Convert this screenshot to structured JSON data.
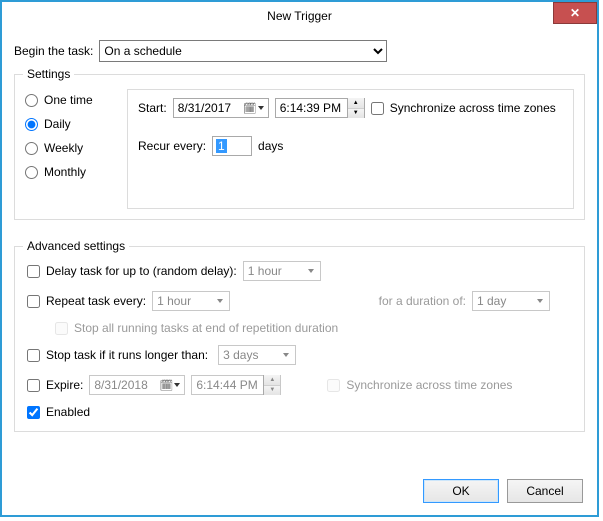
{
  "window": {
    "title": "New Trigger"
  },
  "begin": {
    "label": "Begin the task:",
    "selected": "On a schedule"
  },
  "settings": {
    "group_label": "Settings",
    "options": {
      "one_time": "One time",
      "daily": "Daily",
      "weekly": "Weekly",
      "monthly": "Monthly"
    },
    "selected": "daily",
    "start_label": "Start:",
    "start_date": "8/31/2017",
    "start_time": "6:14:39 PM",
    "sync_tz_label": "Synchronize across time zones",
    "recur_label": "Recur every:",
    "recur_value": "1",
    "recur_unit": "days"
  },
  "advanced": {
    "group_label": "Advanced settings",
    "delay_label": "Delay task for up to (random delay):",
    "delay_value": "1 hour",
    "repeat_label": "Repeat task every:",
    "repeat_value": "1 hour",
    "duration_label": "for a duration of:",
    "duration_value": "1 day",
    "stop_repeat_label": "Stop all running tasks at end of repetition duration",
    "stop_long_label": "Stop task if it runs longer than:",
    "stop_long_value": "3 days",
    "expire_label": "Expire:",
    "expire_date": "8/31/2018",
    "expire_time": "6:14:44 PM",
    "expire_sync_label": "Synchronize across time zones",
    "enabled_label": "Enabled"
  },
  "buttons": {
    "ok": "OK",
    "cancel": "Cancel"
  }
}
